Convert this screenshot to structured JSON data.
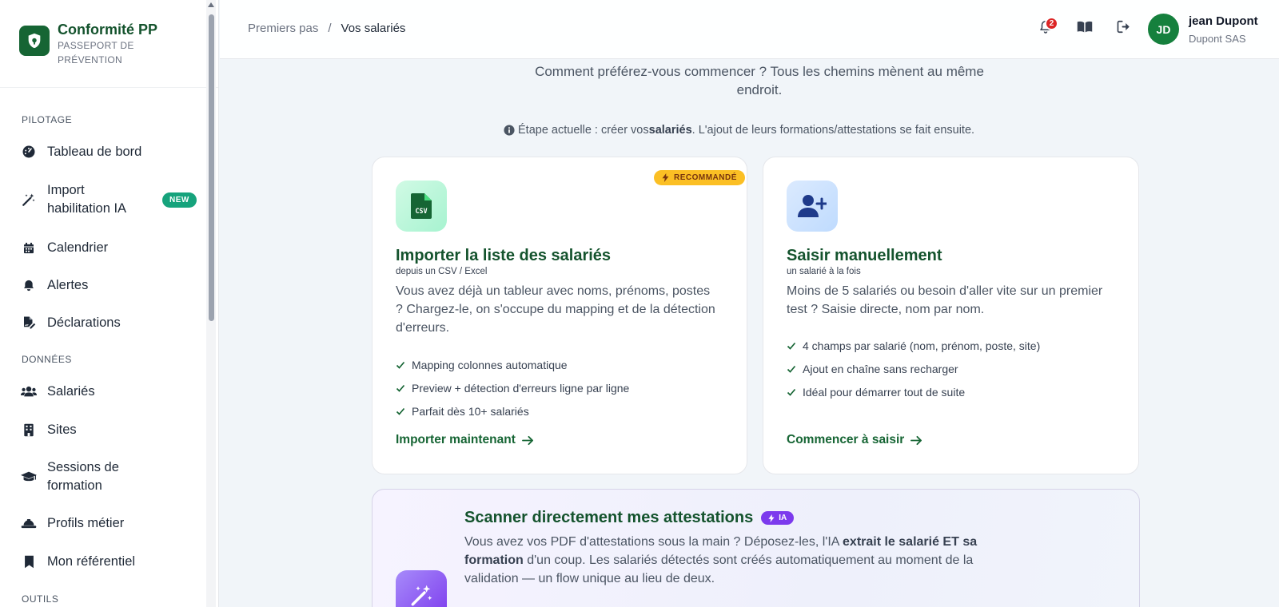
{
  "brand": {
    "title": "Conformité PP",
    "subtitle": "PASSEPORT DE PRÉVENTION"
  },
  "sidebar": {
    "sections": [
      "PILOTAGE",
      "DONNÉES",
      "OUTILS"
    ],
    "items": [
      {
        "label": "Tableau de bord",
        "icon": "gauge-icon"
      },
      {
        "label": "Import habilitation IA",
        "icon": "magic-wand-icon",
        "badge": "NEW"
      },
      {
        "label": "Calendrier",
        "icon": "calendar-icon"
      },
      {
        "label": "Alertes",
        "icon": "bell-icon"
      },
      {
        "label": "Déclarations",
        "icon": "file-signature-icon"
      },
      {
        "label": "Salariés",
        "icon": "users-icon"
      },
      {
        "label": "Sites",
        "icon": "building-icon"
      },
      {
        "label": "Sessions de formation",
        "icon": "graduation-cap-icon"
      },
      {
        "label": "Profils métier",
        "icon": "hard-hat-icon"
      },
      {
        "label": "Mon référentiel",
        "icon": "bookmark-icon"
      }
    ]
  },
  "header": {
    "breadcrumb": [
      "Premiers pas",
      "Vos salariés"
    ],
    "separator": "/",
    "notifications": "2",
    "user": {
      "initials": "JD",
      "name": "jean Dupont",
      "company": "Dupont SAS"
    }
  },
  "main": {
    "intro": "Comment préférez-vous commencer ? Tous les chemins mènent au même endroit.",
    "step_note": {
      "prefix": "Étape actuelle : créer vos ",
      "strong": "salariés",
      "suffix": ". L'ajout de leurs formations/attestations se fait ensuite."
    },
    "cards": [
      {
        "badge": "RECOMMANDÉ",
        "icon_label": "CSV",
        "title": "Importer la liste des salariés",
        "subtitle": "depuis un CSV / Excel",
        "description": "Vous avez déjà un tableur avec noms, prénoms, postes ? Chargez-le, on s'occupe du mapping et de la détection d'erreurs.",
        "features": [
          "Mapping colonnes automatique",
          "Preview + détection d'erreurs ligne par ligne",
          "Parfait dès 10+ salariés"
        ],
        "cta": "Importer maintenant"
      },
      {
        "title": "Saisir manuellement",
        "subtitle": "un salarié à la fois",
        "description": "Moins de 5 salariés ou besoin d'aller vite sur un premier test ? Saisie directe, nom par nom.",
        "features": [
          "4 champs par salarié (nom, prénom, poste, site)",
          "Ajout en chaîne sans recharger",
          "Idéal pour démarrer tout de suite"
        ],
        "cta": "Commencer à saisir"
      }
    ],
    "scan": {
      "title": "Scanner directement mes attestations",
      "badge": "IA",
      "desc_1": "Vous avez vos PDF d'attestations sous la main ? Déposez-les, l'IA ",
      "desc_strong": "extrait le salarié ET sa formation",
      "desc_2": " d'un coup. Les salariés détectés sont créés automatiquement au moment de la validation — un flow unique au lieu de deux."
    }
  },
  "colors": {
    "brand": "#166534",
    "accent": "#16a37c",
    "notification": "#dc2626",
    "recommended": "#fbbf24",
    "ia": "#7c3aed"
  }
}
